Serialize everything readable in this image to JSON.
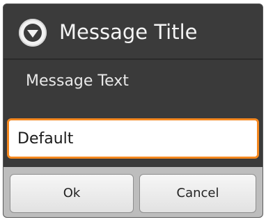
{
  "dialog": {
    "title": "Message Title",
    "title_icon": "chevron-down-circle-icon",
    "message": "Message Text",
    "input": {
      "value": "Default",
      "placeholder": ""
    },
    "buttons": {
      "ok_label": "Ok",
      "cancel_label": "Cancel"
    }
  },
  "colors": {
    "focus_border": "#f5881f",
    "dialog_bg": "#3a3a3a",
    "button_bar_bg": "#bdbdbd"
  }
}
